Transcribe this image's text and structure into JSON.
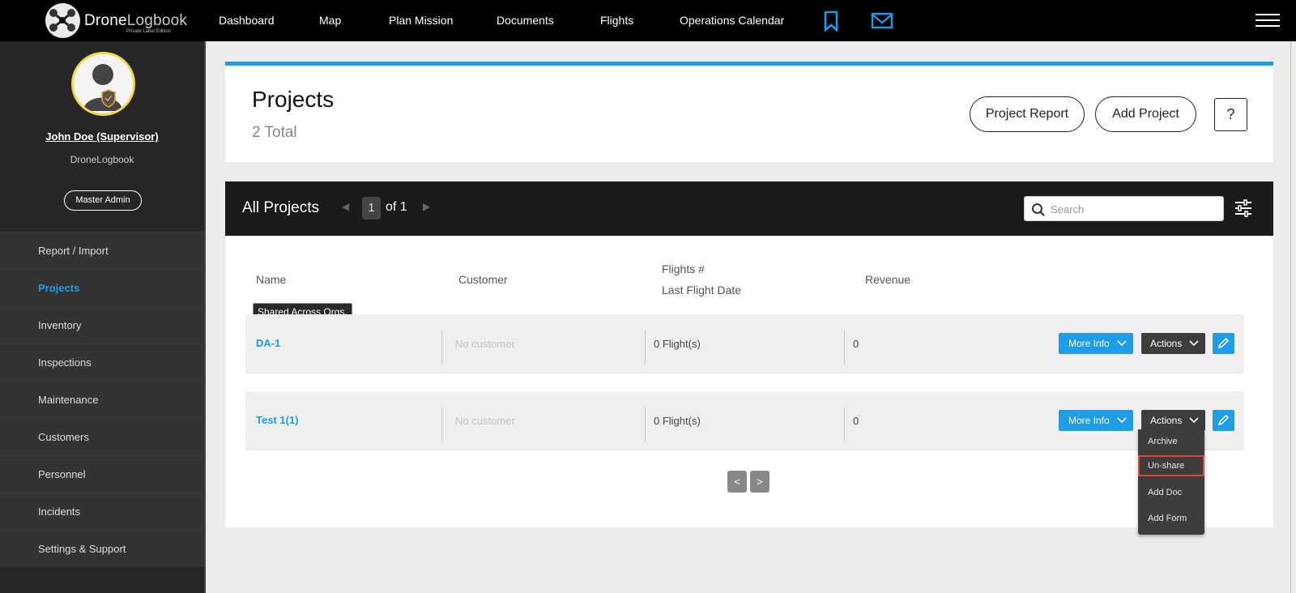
{
  "brand": {
    "name_bold": "Drone",
    "name_thin": "Logbook",
    "subtitle": "Private Label Edition"
  },
  "nav": {
    "items": [
      "Dashboard",
      "Map",
      "Plan Mission",
      "Documents",
      "Flights",
      "Operations Calendar"
    ],
    "icons": [
      "bookmark-icon",
      "mail-icon",
      "hamburger-menu-icon"
    ],
    "accent": "#1e9ce6"
  },
  "profile": {
    "name": "John Doe (Supervisor)",
    "org": "DroneLogbook",
    "role": "Master Admin",
    "ring_color": "#f2d94a"
  },
  "sidebar": {
    "items": [
      {
        "label": "Report / Import",
        "active": false
      },
      {
        "label": "Projects",
        "active": true
      },
      {
        "label": "Inventory",
        "active": false
      },
      {
        "label": "Inspections",
        "active": false
      },
      {
        "label": "Maintenance",
        "active": false
      },
      {
        "label": "Customers",
        "active": false
      },
      {
        "label": "Personnel",
        "active": false
      },
      {
        "label": "Incidents",
        "active": false
      },
      {
        "label": "Settings & Support",
        "active": false
      }
    ]
  },
  "header": {
    "title": "Projects",
    "total": "2 Total",
    "report_btn": "Project Report",
    "add_btn": "Add Project",
    "help": "?"
  },
  "list": {
    "title": "All Projects",
    "page": "1",
    "of": "of 1",
    "search_placeholder": "Search",
    "columns": {
      "name": "Name",
      "customer": "Customer",
      "flights": "Flights #",
      "last_flight": "Last Flight Date",
      "revenue": "Revenue"
    },
    "tooltip": "Shared Across Orgs.",
    "rows": [
      {
        "name": "DA-1",
        "customer": "No customer",
        "flights": "0 Flight(s)",
        "revenue": "0"
      },
      {
        "name": "Test 1(1)",
        "customer": "No customer",
        "flights": "0 Flight(s)",
        "revenue": "0"
      }
    ],
    "more_info": "More Info",
    "actions": "Actions",
    "dropdown": [
      "Archive",
      "Un-share",
      "Add Doc",
      "Add Form"
    ],
    "prev": "<",
    "next": ">"
  }
}
